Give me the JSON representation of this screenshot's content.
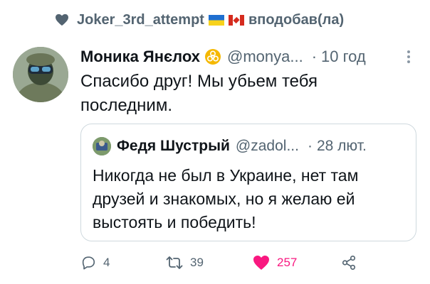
{
  "liked_by": {
    "user": "Joker_3rd_attempt",
    "action": "вподобав(ла)",
    "flags": [
      "ukraine-flag",
      "canada-flag"
    ]
  },
  "tweet": {
    "display_name": "Моника Янєлох",
    "badge_icon": "biohazard-badge-icon",
    "handle": "@monya...",
    "separator": "·",
    "time": "10 год",
    "text": "Спасибо друг! Мы убьем тебя последним."
  },
  "quote": {
    "display_name": "Федя Шустрый",
    "handle": "@zadol...",
    "separator": "·",
    "time": "28 лют.",
    "text": "Никогда не был в Украине, нет там друзей и знакомых, но я желаю ей выстоять и победить!"
  },
  "actions": {
    "reply_count": "4",
    "retweet_count": "39",
    "like_count": "257",
    "like_color": "#f91880"
  },
  "colors": {
    "secondary_text": "#536471",
    "primary_text": "#0f1419",
    "border": "#cfd9de",
    "badge": "#f5b800"
  }
}
